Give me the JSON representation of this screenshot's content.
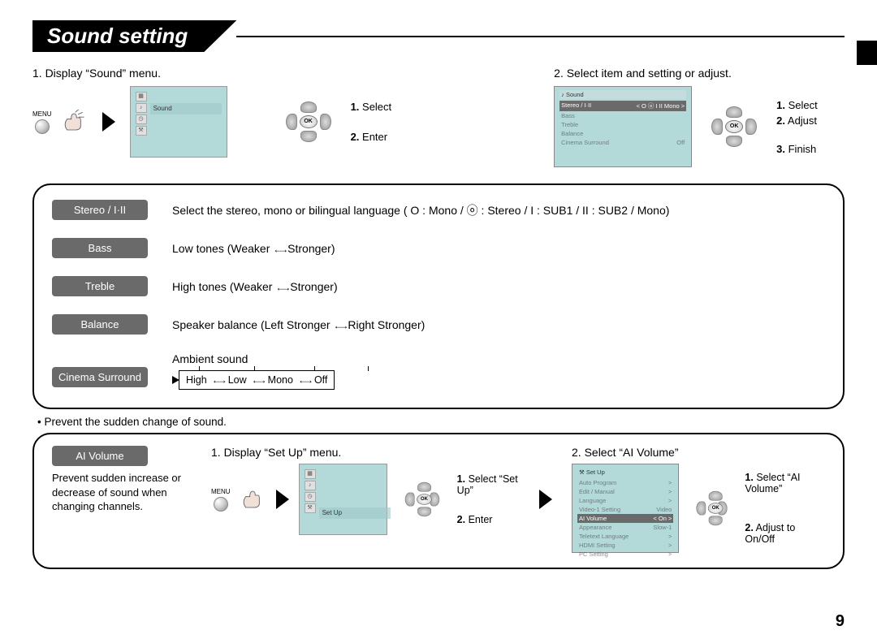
{
  "page": {
    "title": "Sound setting",
    "number": "9"
  },
  "steps": {
    "s1": {
      "text": "1. Display “Sound” menu."
    },
    "s2": {
      "text": "2. Select item and setting or adjust."
    }
  },
  "remote": {
    "menu_label": "MENU",
    "ok": "OK"
  },
  "step1_labels": {
    "l1_num": "1.",
    "l1_txt": " Select",
    "l2_num": "2.",
    "l2_txt": " Enter"
  },
  "step2_labels": {
    "l1_num": "1.",
    "l1_txt": " Select",
    "l2_num": "2.",
    "l2_txt": " Adjust",
    "l3_num": "3.",
    "l3_txt": " Finish"
  },
  "tv_menu": {
    "sound_label": "Sound"
  },
  "sound_screen": {
    "title": "Sound",
    "row1_l": "Stereo / I·II",
    "row1_r": "<   O  ⓞ  I  II  Mono   >",
    "row2": "Bass",
    "row3": "Treble",
    "row4": "Balance",
    "row5_l": "Cinema Surround",
    "row5_r": "Off"
  },
  "table": {
    "stereo": {
      "label": "Stereo / I·II",
      "desc": "Select the stereo, mono or bilingual language ( O : Mono / ⓞ : Stereo / I : SUB1 / II : SUB2 / Mono)"
    },
    "bass": {
      "label": "Bass",
      "desc_a": "Low tones (Weaker ",
      "desc_b": " Stronger)"
    },
    "treble": {
      "label": "Treble",
      "desc_a": "High tones (Weaker ",
      "desc_b": " Stronger)"
    },
    "balance": {
      "label": "Balance",
      "desc_a": "Speaker balance (Left Stronger ",
      "desc_b": " Right Stronger)"
    },
    "cs": {
      "label": "Cinema Surround",
      "desc1": "Ambient sound",
      "opt1": "High",
      "opt2": "Low",
      "opt3": "Mono",
      "opt4": "Off"
    }
  },
  "note": {
    "text": "• Prevent the sudden change of sound."
  },
  "ai": {
    "label": "AI Volume",
    "desc": "Prevent sudden increase or decrease of sound when changing channels.",
    "step1": "1. Display “Set Up” menu.",
    "step2": "2. Select “AI Volume”",
    "mid_l1a": "1.",
    "mid_l1b": " Select “Set Up”",
    "mid_l2a": "2.",
    "mid_l2b": " Enter",
    "r_l1a": "1.",
    "r_l1b": " Select “AI Volume”",
    "r_l2a": "2.",
    "r_l2b": " Adjust to On/Off"
  },
  "setup_tv": {
    "label": "Set Up"
  },
  "setup_screen": {
    "title": "Set Up",
    "r1": "Auto Program",
    "r2": "Edit / Manual",
    "r3": "Language",
    "r4": "Video-1 Setting",
    "r4v": "Video",
    "r5": "AI Volume",
    "r5v": "<        On        >",
    "r6": "Appearance",
    "r6v": "Slow-1",
    "r7": "Teletext Language",
    "r8": "HDMI Setting",
    "r9": "PC Setting"
  }
}
